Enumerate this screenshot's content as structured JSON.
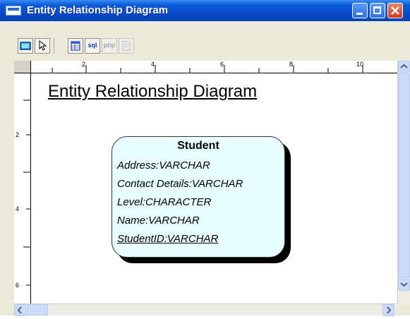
{
  "window": {
    "title": "Entity Relationship Diagram",
    "titlebar_color": "#0a5ad8"
  },
  "toolbar": {
    "tools": [
      {
        "name": "screen-view-tool",
        "icon": "monitor-icon",
        "label": ""
      },
      {
        "name": "pointer-tool",
        "icon": "cursor-icon",
        "label": ""
      },
      {
        "name": "table-tool",
        "icon": "table-icon",
        "label": ""
      },
      {
        "name": "sql-tool",
        "icon": "sql-icon",
        "label": "sql"
      },
      {
        "name": "php-tool",
        "icon": "php-icon",
        "label": "php",
        "disabled": true
      },
      {
        "name": "export-tool",
        "icon": "export-icon",
        "label": "",
        "disabled": true
      }
    ]
  },
  "ruler": {
    "horizontal_labels": [
      "2",
      "4",
      "6",
      "8",
      "10"
    ],
    "vertical_labels": [
      "2",
      "4",
      "6"
    ]
  },
  "diagram": {
    "title": "Entity Relationship Diagram",
    "entity": {
      "name": "Student",
      "fill_color": "#e9ffff",
      "attributes": [
        {
          "text": "Address:VARCHAR",
          "primary_key": false
        },
        {
          "text": "Contact Details:VARCHAR",
          "primary_key": false
        },
        {
          "text": "Level:CHARACTER",
          "primary_key": false
        },
        {
          "text": "Name:VARCHAR",
          "primary_key": false
        },
        {
          "text": "StudentID:VARCHAR",
          "primary_key": true
        }
      ]
    }
  }
}
